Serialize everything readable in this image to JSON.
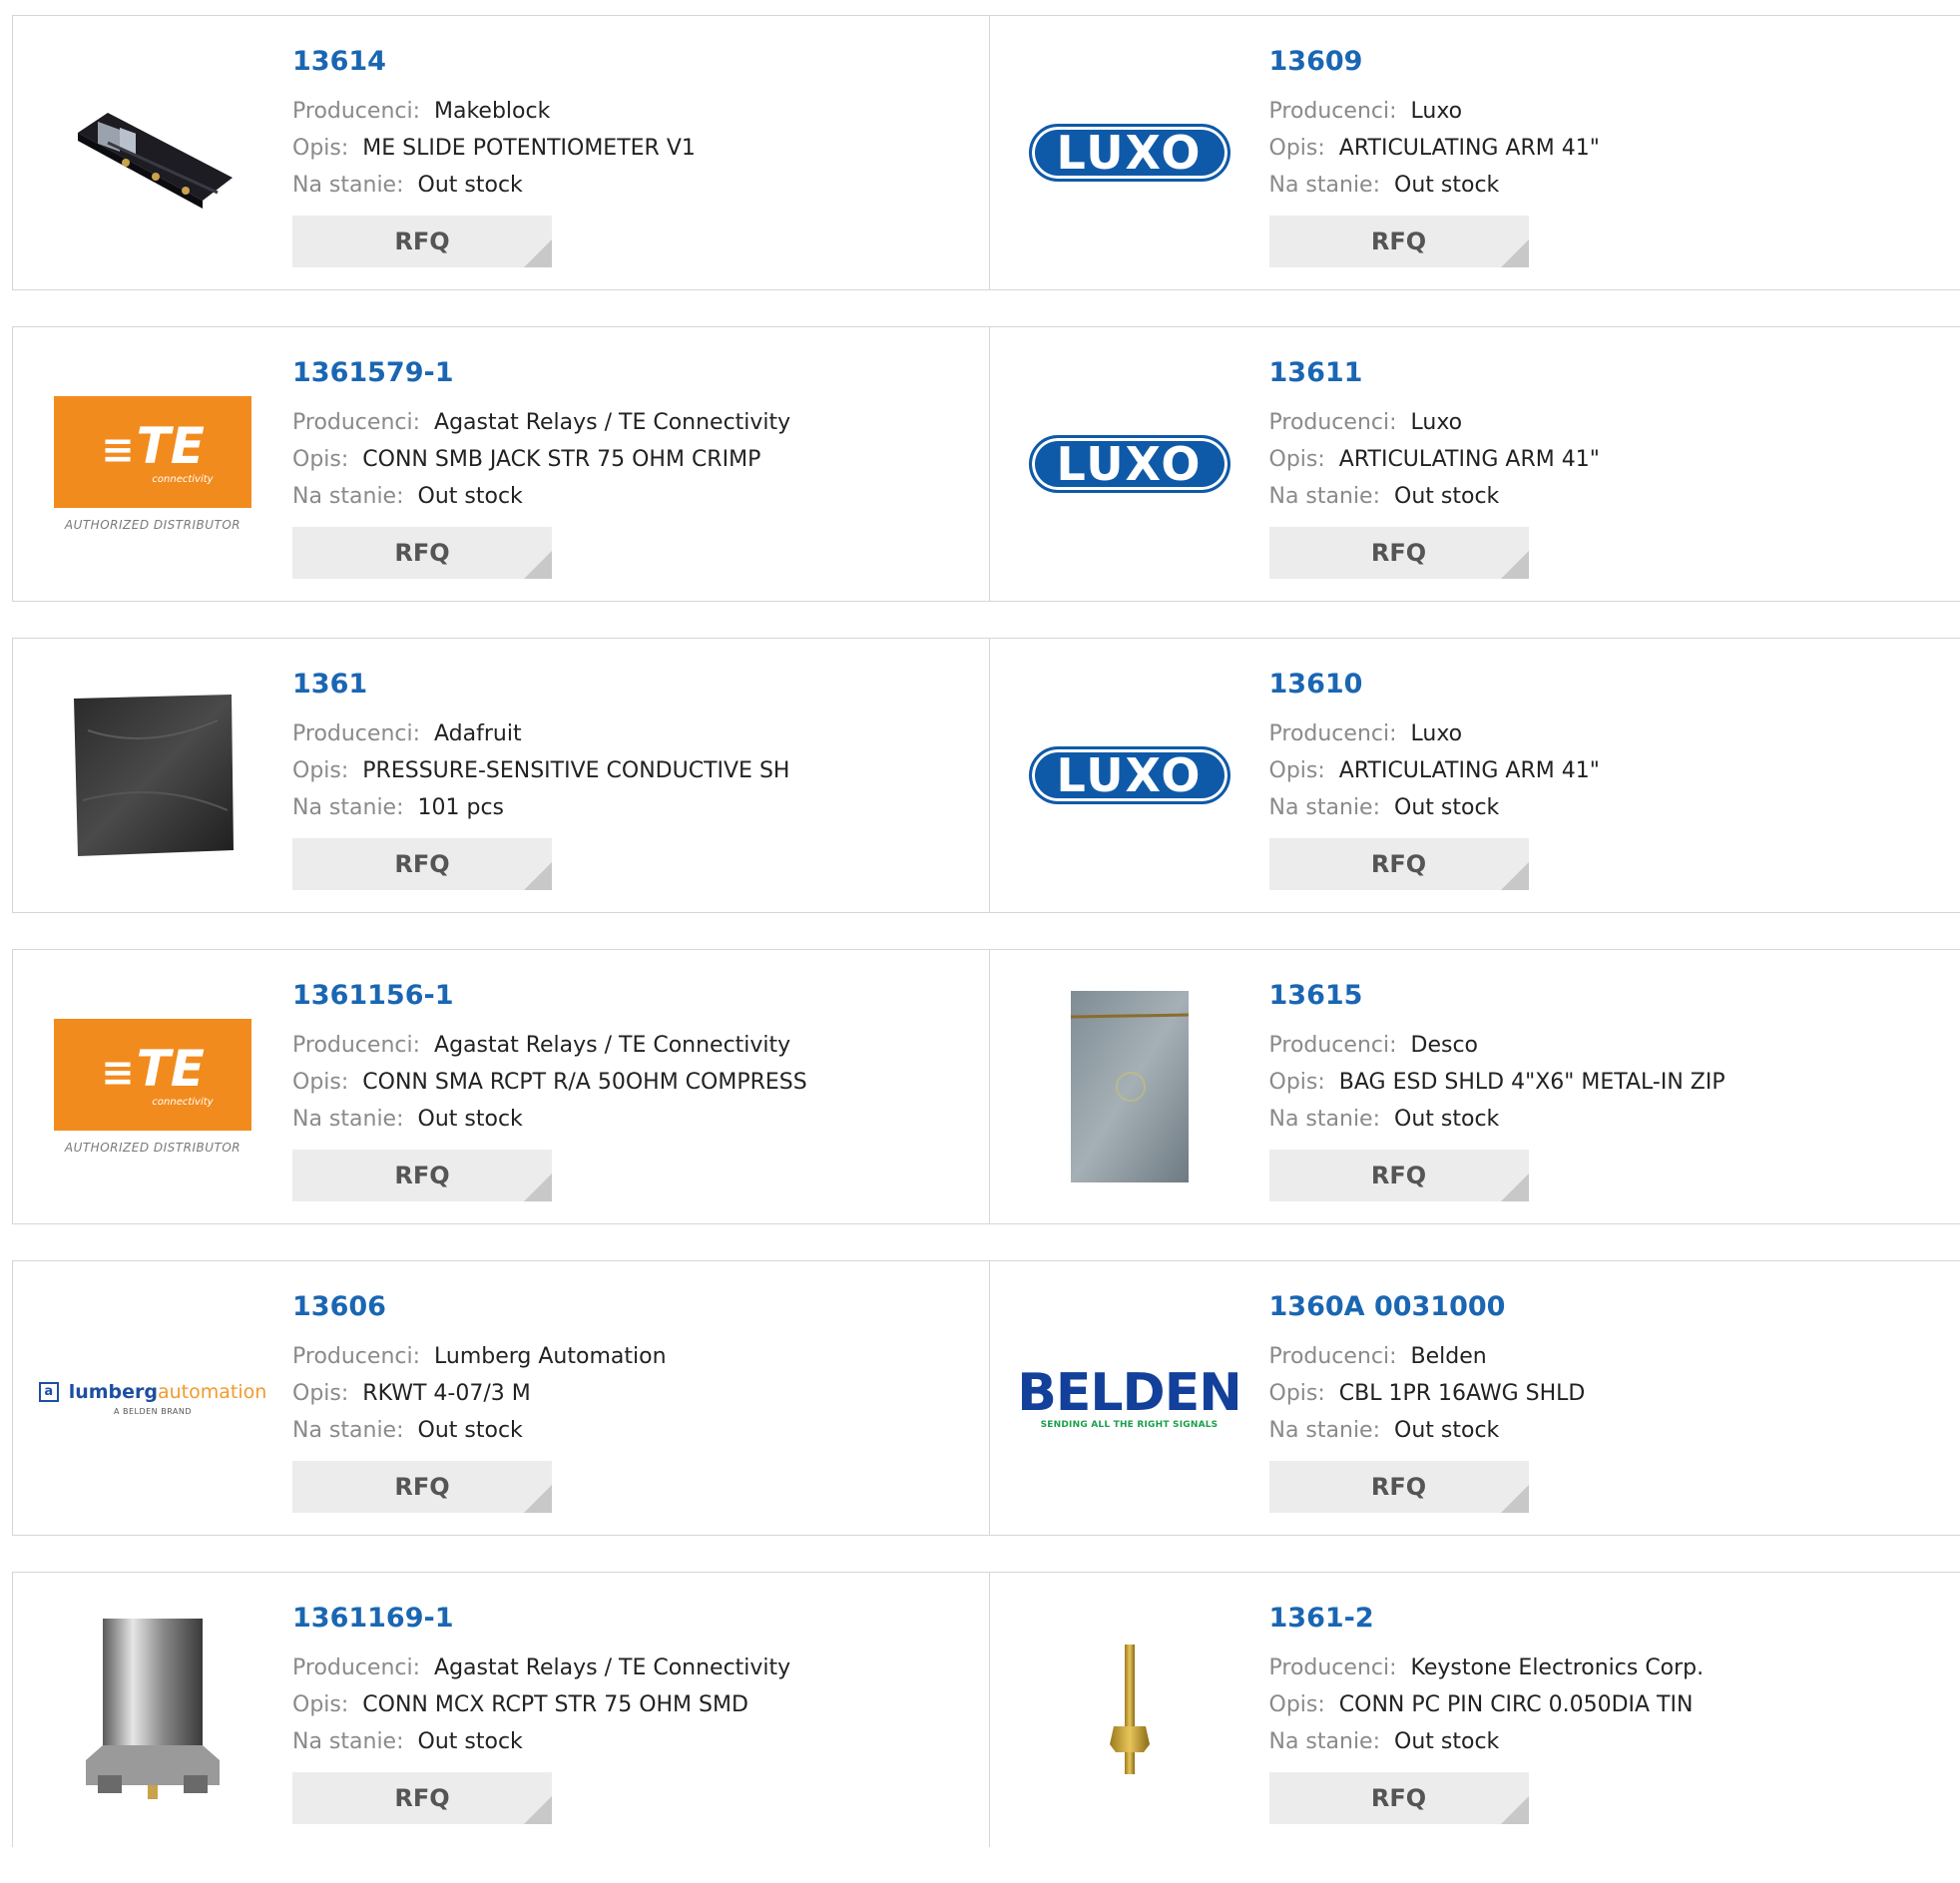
{
  "labels": {
    "manufacturer": "Producenci:",
    "description": "Opis:",
    "stock": "Na stanie:",
    "rfq": "RFQ"
  },
  "products": [
    {
      "part": "13614",
      "manufacturer": "Makeblock",
      "description": "ME SLIDE POTENTIOMETER V1",
      "stock": "Out stock",
      "image": "slide-potentiometer-photo"
    },
    {
      "part": "13609",
      "manufacturer": "Luxo",
      "description": "ARTICULATING ARM 41\"",
      "stock": "Out stock",
      "image": "luxo-logo",
      "logo_text": "LUXO"
    },
    {
      "part": "1361579-1",
      "manufacturer": "Agastat Relays / TE Connectivity",
      "description": "CONN SMB JACK STR 75 OHM CRIMP",
      "stock": "Out stock",
      "image": "te-connectivity-logo",
      "logo_text": "TE",
      "logo_sub": "connectivity",
      "logo_caption": "AUTHORIZED DISTRIBUTOR"
    },
    {
      "part": "13611",
      "manufacturer": "Luxo",
      "description": "ARTICULATING ARM 41\"",
      "stock": "Out stock",
      "image": "luxo-logo",
      "logo_text": "LUXO"
    },
    {
      "part": "1361",
      "manufacturer": "Adafruit",
      "description": "PRESSURE-SENSITIVE CONDUCTIVE SH",
      "stock": "101 pcs",
      "image": "conductive-sheet-photo"
    },
    {
      "part": "13610",
      "manufacturer": "Luxo",
      "description": "ARTICULATING ARM 41\"",
      "stock": "Out stock",
      "image": "luxo-logo",
      "logo_text": "LUXO"
    },
    {
      "part": "1361156-1",
      "manufacturer": "Agastat Relays / TE Connectivity",
      "description": "CONN SMA RCPT R/A 50OHM COMPRESS",
      "stock": "Out stock",
      "image": "te-connectivity-logo",
      "logo_text": "TE",
      "logo_sub": "connectivity",
      "logo_caption": "AUTHORIZED DISTRIBUTOR"
    },
    {
      "part": "13615",
      "manufacturer": "Desco",
      "description": "BAG ESD SHLD 4\"X6\" METAL-IN ZIP",
      "stock": "Out stock",
      "image": "esd-bag-photo"
    },
    {
      "part": "13606",
      "manufacturer": "Lumberg Automation",
      "description": "RKWT 4-07/3 M",
      "stock": "Out stock",
      "image": "lumberg-automation-logo",
      "logo_text_a": "lumberg",
      "logo_text_b": "automation",
      "logo_sub": "A BELDEN BRAND"
    },
    {
      "part": "1360A 0031000",
      "manufacturer": "Belden",
      "description": "CBL 1PR 16AWG SHLD",
      "stock": "Out stock",
      "image": "belden-logo",
      "logo_text": "BELDEN",
      "logo_sub": "SENDING ALL THE RIGHT SIGNALS"
    },
    {
      "part": "1361169-1",
      "manufacturer": "Agastat Relays / TE Connectivity",
      "description": "CONN MCX RCPT STR 75 OHM SMD",
      "stock": "Out stock",
      "image": "mcx-connector-photo"
    },
    {
      "part": "1361-2",
      "manufacturer": "Keystone Electronics Corp.",
      "description": "CONN PC PIN CIRC 0.050DIA TIN",
      "stock": "Out stock",
      "image": "pc-pin-photo"
    }
  ],
  "colors": {
    "part_link": "#1a66b3",
    "label": "#8a8a8a",
    "rfq_bg": "#ececec",
    "border": "#d6d6d6"
  }
}
